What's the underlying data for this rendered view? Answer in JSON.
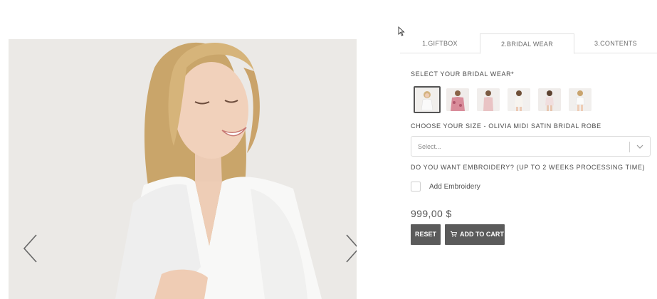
{
  "tabs": [
    {
      "label": "1.GIFTBOX",
      "active": false
    },
    {
      "label": "2.BRIDAL WEAR",
      "active": true
    },
    {
      "label": "3.CONTENTS",
      "active": false
    }
  ],
  "bridal_wear": {
    "heading": "SELECT YOUR BRIDAL WEAR*",
    "swatches": [
      {
        "name": "white-robe",
        "selected": true
      },
      {
        "name": "pink-floral-robe",
        "selected": false
      },
      {
        "name": "blush-set",
        "selected": false
      },
      {
        "name": "ivory-set",
        "selected": false
      },
      {
        "name": "lace-set",
        "selected": false
      },
      {
        "name": "white-short-set",
        "selected": false
      }
    ]
  },
  "size": {
    "heading": "CHOOSE YOUR SIZE - OLIVIA MIDI SATIN BRIDAL ROBE",
    "placeholder": "Select..."
  },
  "embroidery": {
    "heading": "DO YOU WANT EMBROIDERY? (UP TO 2 WEEKS PROCESSING TIME)",
    "checkbox_label": "Add Embroidery",
    "checked": false
  },
  "price": "999,00 $",
  "buttons": {
    "reset": "RESET",
    "add_to_cart": "ADD TO CART"
  },
  "colors": {
    "button_bg": "#5b5b5b",
    "selected_border": "#555555",
    "tab_border": "#e2e2e2"
  }
}
